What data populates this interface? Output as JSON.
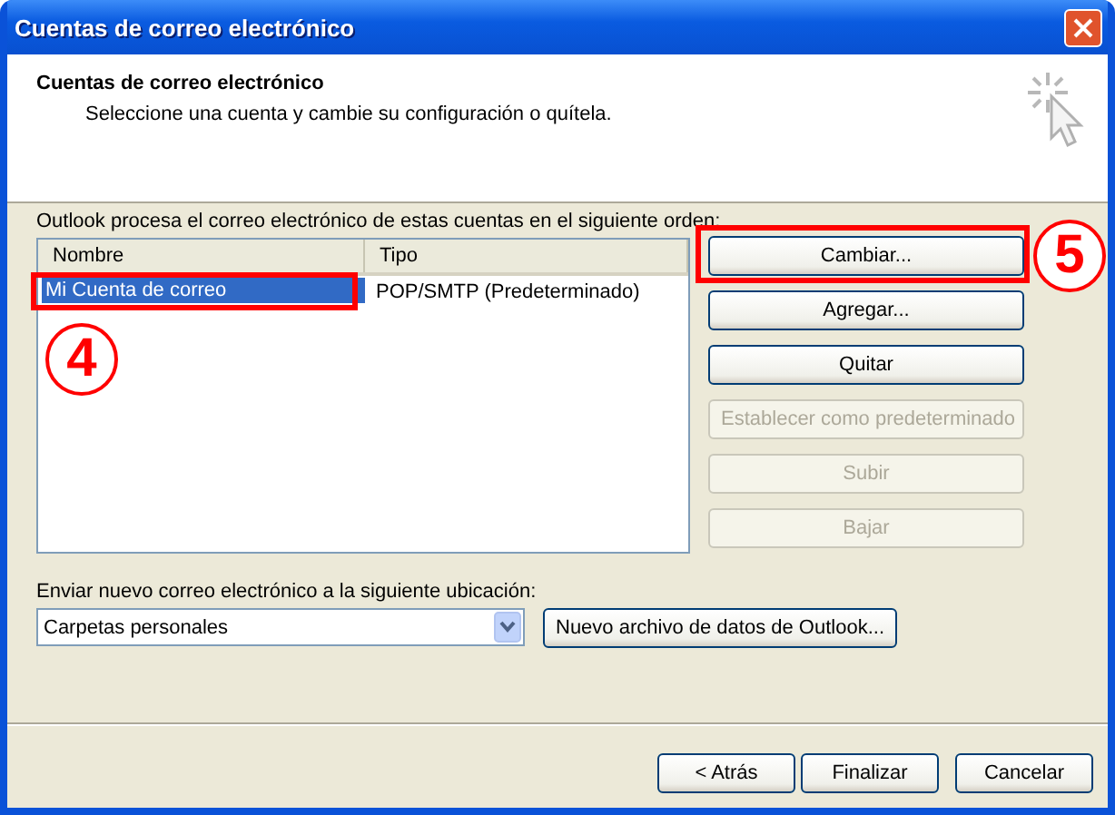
{
  "window": {
    "title": "Cuentas de correo electrónico"
  },
  "header": {
    "title": "Cuentas de correo electrónico",
    "subtitle": "Seleccione una cuenta y cambie su configuración o quítela."
  },
  "list_label": "Outlook procesa el correo electrónico de estas cuentas en el siguiente orden:",
  "table": {
    "columns": [
      "Nombre",
      "Tipo"
    ],
    "rows": [
      {
        "cells": [
          "Mi Cuenta de correo",
          "POP/SMTP (Predeterminado)"
        ],
        "selected": true
      }
    ]
  },
  "side_buttons": [
    {
      "label": "Cambiar...",
      "disabled": false
    },
    {
      "label": "Agregar...",
      "disabled": false
    },
    {
      "label": "Quitar",
      "disabled": false
    },
    {
      "label": "Establecer como predeterminado",
      "disabled": true
    },
    {
      "label": "Subir",
      "disabled": true
    },
    {
      "label": "Bajar",
      "disabled": true
    }
  ],
  "delivery": {
    "label": "Enviar nuevo correo electrónico a la siguiente ubicación:",
    "value": "Carpetas personales",
    "button": "Nuevo archivo de datos de Outlook..."
  },
  "footer_buttons": [
    {
      "label": "< Atrás"
    },
    {
      "label": "Finalizar"
    },
    {
      "label": "Cancelar"
    }
  ],
  "annotations": [
    {
      "label": "4"
    },
    {
      "label": "5"
    }
  ]
}
